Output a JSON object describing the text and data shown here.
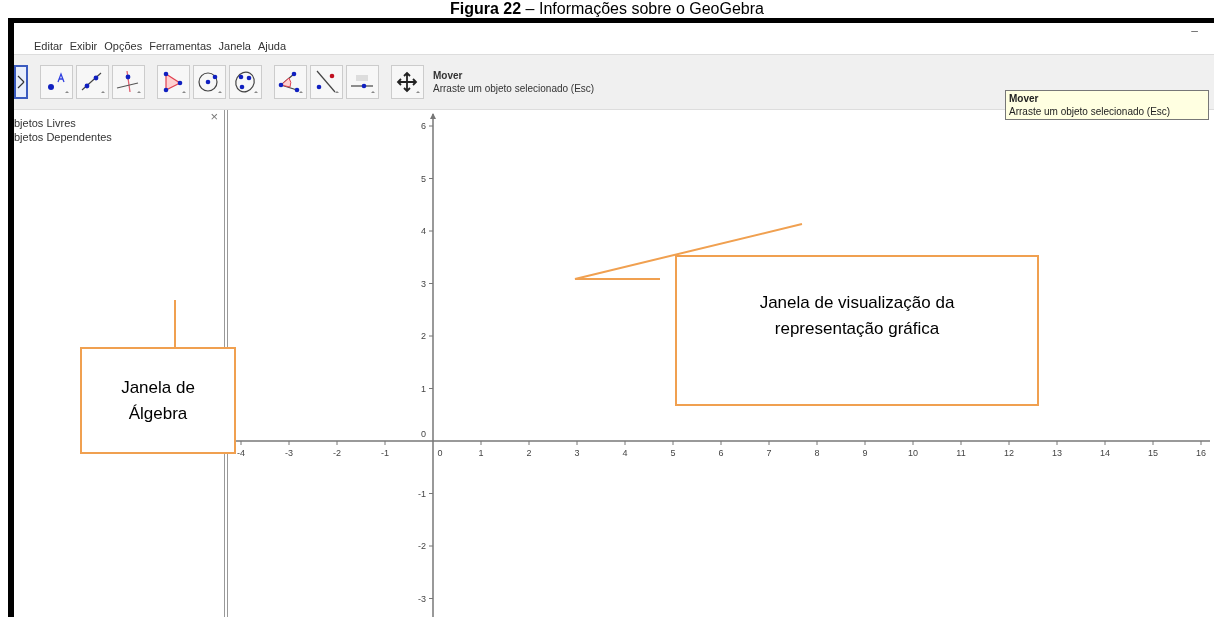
{
  "caption": "**Figura 22** – Informações sobre o GeoGebra",
  "window": {
    "minimize": "–"
  },
  "menu": [
    "Editar",
    "Exibir",
    "Opções",
    "Ferramentas",
    "Janela",
    "Ajuda"
  ],
  "toolbar": {
    "tools": [
      {
        "kind": "cursor",
        "selected": true
      },
      {
        "kind": "point",
        "selected": false
      },
      {
        "kind": "line",
        "selected": false
      },
      {
        "kind": "perpendicular",
        "selected": false
      },
      {
        "kind": "polygon",
        "selected": false
      },
      {
        "kind": "circle",
        "selected": false
      },
      {
        "kind": "conic",
        "selected": false
      },
      {
        "kind": "angle",
        "selected": false
      },
      {
        "kind": "reflect",
        "selected": false
      },
      {
        "kind": "slider",
        "selected": false
      },
      {
        "kind": "pan",
        "selected": false
      }
    ],
    "tool_name": "Mover",
    "tool_help": "Arraste um objeto selecionado (Esc)"
  },
  "tooltip": {
    "title": "Mover",
    "text": "Arraste um objeto selecionado (Esc)"
  },
  "algebra_view": {
    "close": "×",
    "items": [
      "bjetos Livres",
      "bjetos Dependentes"
    ]
  },
  "graphics_view": {
    "x_axis_labels": [
      "-4",
      "-3",
      "-2",
      "-1",
      "0",
      "1",
      "2",
      "3",
      "4",
      "5",
      "6",
      "7",
      "8",
      "9",
      "10",
      "11",
      "12",
      "13",
      "14",
      "15",
      "16"
    ],
    "y_axis_labels": [
      "6",
      "5",
      "4",
      "3",
      "2",
      "1",
      "0",
      "-1",
      "-2",
      "-3"
    ]
  },
  "annotations": [
    {
      "text": "Janela de Álgebra"
    },
    {
      "text": "Janela de visualização da representação gráfica"
    }
  ]
}
